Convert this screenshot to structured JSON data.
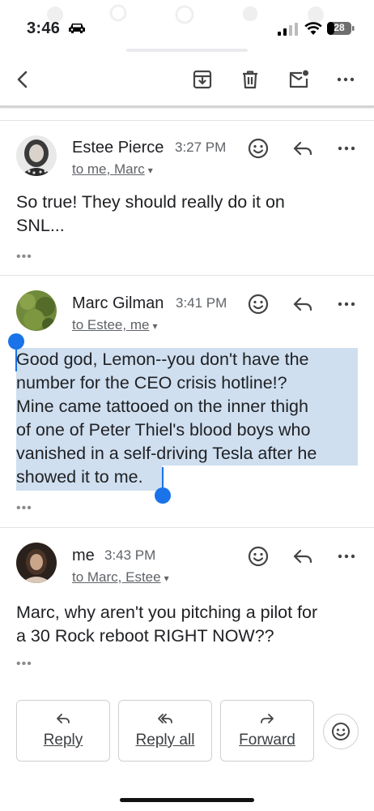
{
  "status_bar": {
    "time": "3:46",
    "battery": "28"
  },
  "toolbar": {
    "back_icon": "arrow-back-icon",
    "archive_icon": "archive-icon",
    "delete_icon": "trash-icon",
    "mark_unread_icon": "mark-unread-icon",
    "more_icon": "more-horizontal-icon"
  },
  "messages": [
    {
      "sender": "Estee Pierce",
      "time": "3:27 PM",
      "recipients": "to me, Marc",
      "body_lines": [
        "So true! They should really do it on",
        "SNL..."
      ],
      "collapsed_indicator": "•••"
    },
    {
      "sender": "Marc Gilman",
      "time": "3:41 PM",
      "recipients": "to Estee, me",
      "body_lines": [
        "Good god, Lemon--you don't have the",
        "number for the CEO crisis hotline!?",
        "Mine came tattooed on the inner thigh",
        "of one of Peter Thiel's blood boys who",
        "vanished in a self-driving Tesla after he",
        "showed it to me."
      ],
      "selected": true,
      "collapsed_indicator": "•••"
    },
    {
      "sender": "me",
      "time": "3:43 PM",
      "recipients": "to Marc, Estee",
      "body_lines": [
        "Marc, why aren't you pitching a pilot for",
        "a 30 Rock reboot RIGHT NOW??"
      ],
      "collapsed_indicator": "•••"
    }
  ],
  "actions": {
    "reply": "Reply",
    "reply_all": "Reply all",
    "forward": "Forward"
  },
  "colors": {
    "selection": "#cfdff0",
    "handle": "#1a73e8"
  }
}
